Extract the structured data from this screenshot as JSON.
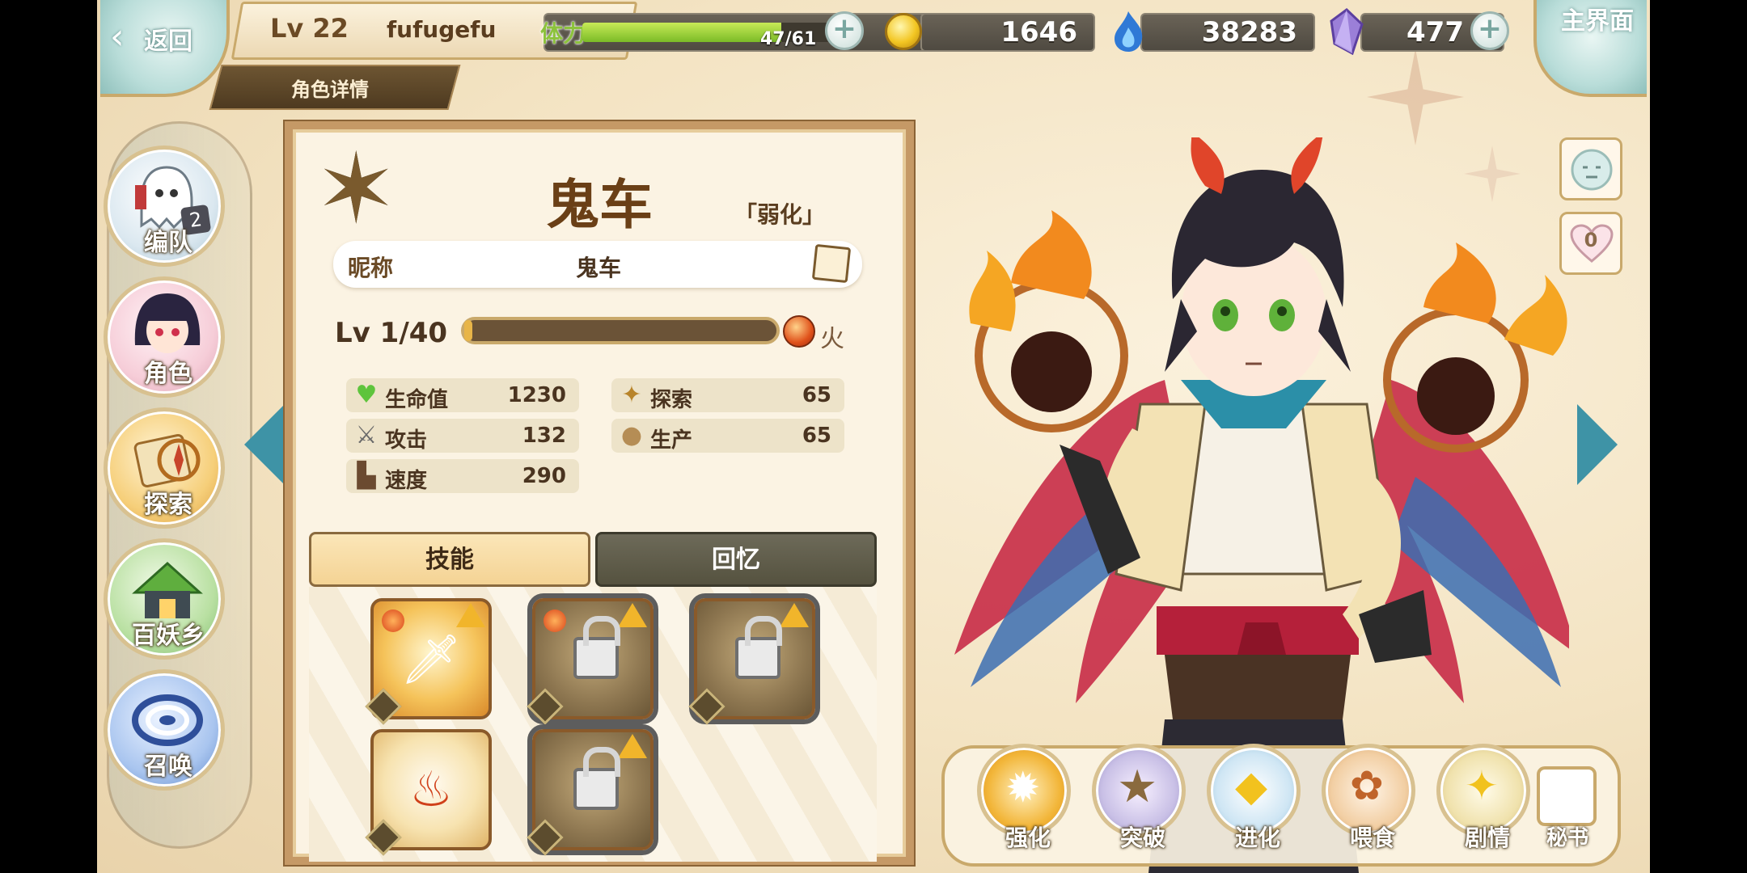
{
  "header": {
    "back_label": "返回",
    "player_level": "Lv 22",
    "player_name": "fufugefu",
    "page_subtitle": "角色详情",
    "stamina_label": "体力",
    "stamina_text": "47/61",
    "stamina_fraction": 0.77,
    "gold": "1646",
    "spirit": "38283",
    "crystal": "477",
    "main_menu_label": "主界面",
    "colors": {
      "stamina": "#8cc23c",
      "resource_bar": "#5a544a",
      "frame": "#c9a96b"
    }
  },
  "sidebar": {
    "items": [
      {
        "label": "编队",
        "badge": "2",
        "icon": "ghost-team-icon"
      },
      {
        "label": "角色",
        "icon": "character-portrait-icon"
      },
      {
        "label": "探索",
        "icon": "explore-scroll-icon"
      },
      {
        "label": "百妖乡",
        "icon": "village-icon"
      },
      {
        "label": "召唤",
        "icon": "summon-vortex-icon"
      }
    ]
  },
  "card": {
    "name": "鬼车",
    "status": "「弱化」",
    "nickname_label": "昵称",
    "nickname": "鬼车",
    "level_text": "Lv 1/40",
    "level_fraction": 0.025,
    "element": "火",
    "stats": [
      {
        "name": "生命值",
        "value": "1230",
        "icon": "heart-icon"
      },
      {
        "name": "探索",
        "value": "65",
        "icon": "explore-icon"
      },
      {
        "name": "攻击",
        "value": "132",
        "icon": "sword-icon"
      },
      {
        "name": "生产",
        "value": "65",
        "icon": "sack-icon"
      },
      {
        "name": "速度",
        "value": "290",
        "icon": "boot-icon"
      }
    ],
    "tabs": {
      "skills": "技能",
      "memory": "回忆"
    },
    "skills": [
      {
        "locked": false,
        "icon": "sword-skill-icon"
      },
      {
        "locked": true,
        "icon": "lock-icon"
      },
      {
        "locked": true,
        "icon": "lock-icon"
      },
      {
        "locked": false,
        "icon": "fire-sack-skill-icon"
      },
      {
        "locked": true,
        "icon": "lock-icon"
      }
    ]
  },
  "side": {
    "affection": "0"
  },
  "actions": {
    "items": [
      {
        "label": "强化",
        "icon": "enhance-icon"
      },
      {
        "label": "突破",
        "icon": "breakthrough-icon"
      },
      {
        "label": "进化",
        "icon": "evolve-icon"
      },
      {
        "label": "喂食",
        "icon": "feed-icon"
      },
      {
        "label": "剧情",
        "icon": "story-icon"
      }
    ],
    "secretary_label": "秘书"
  }
}
